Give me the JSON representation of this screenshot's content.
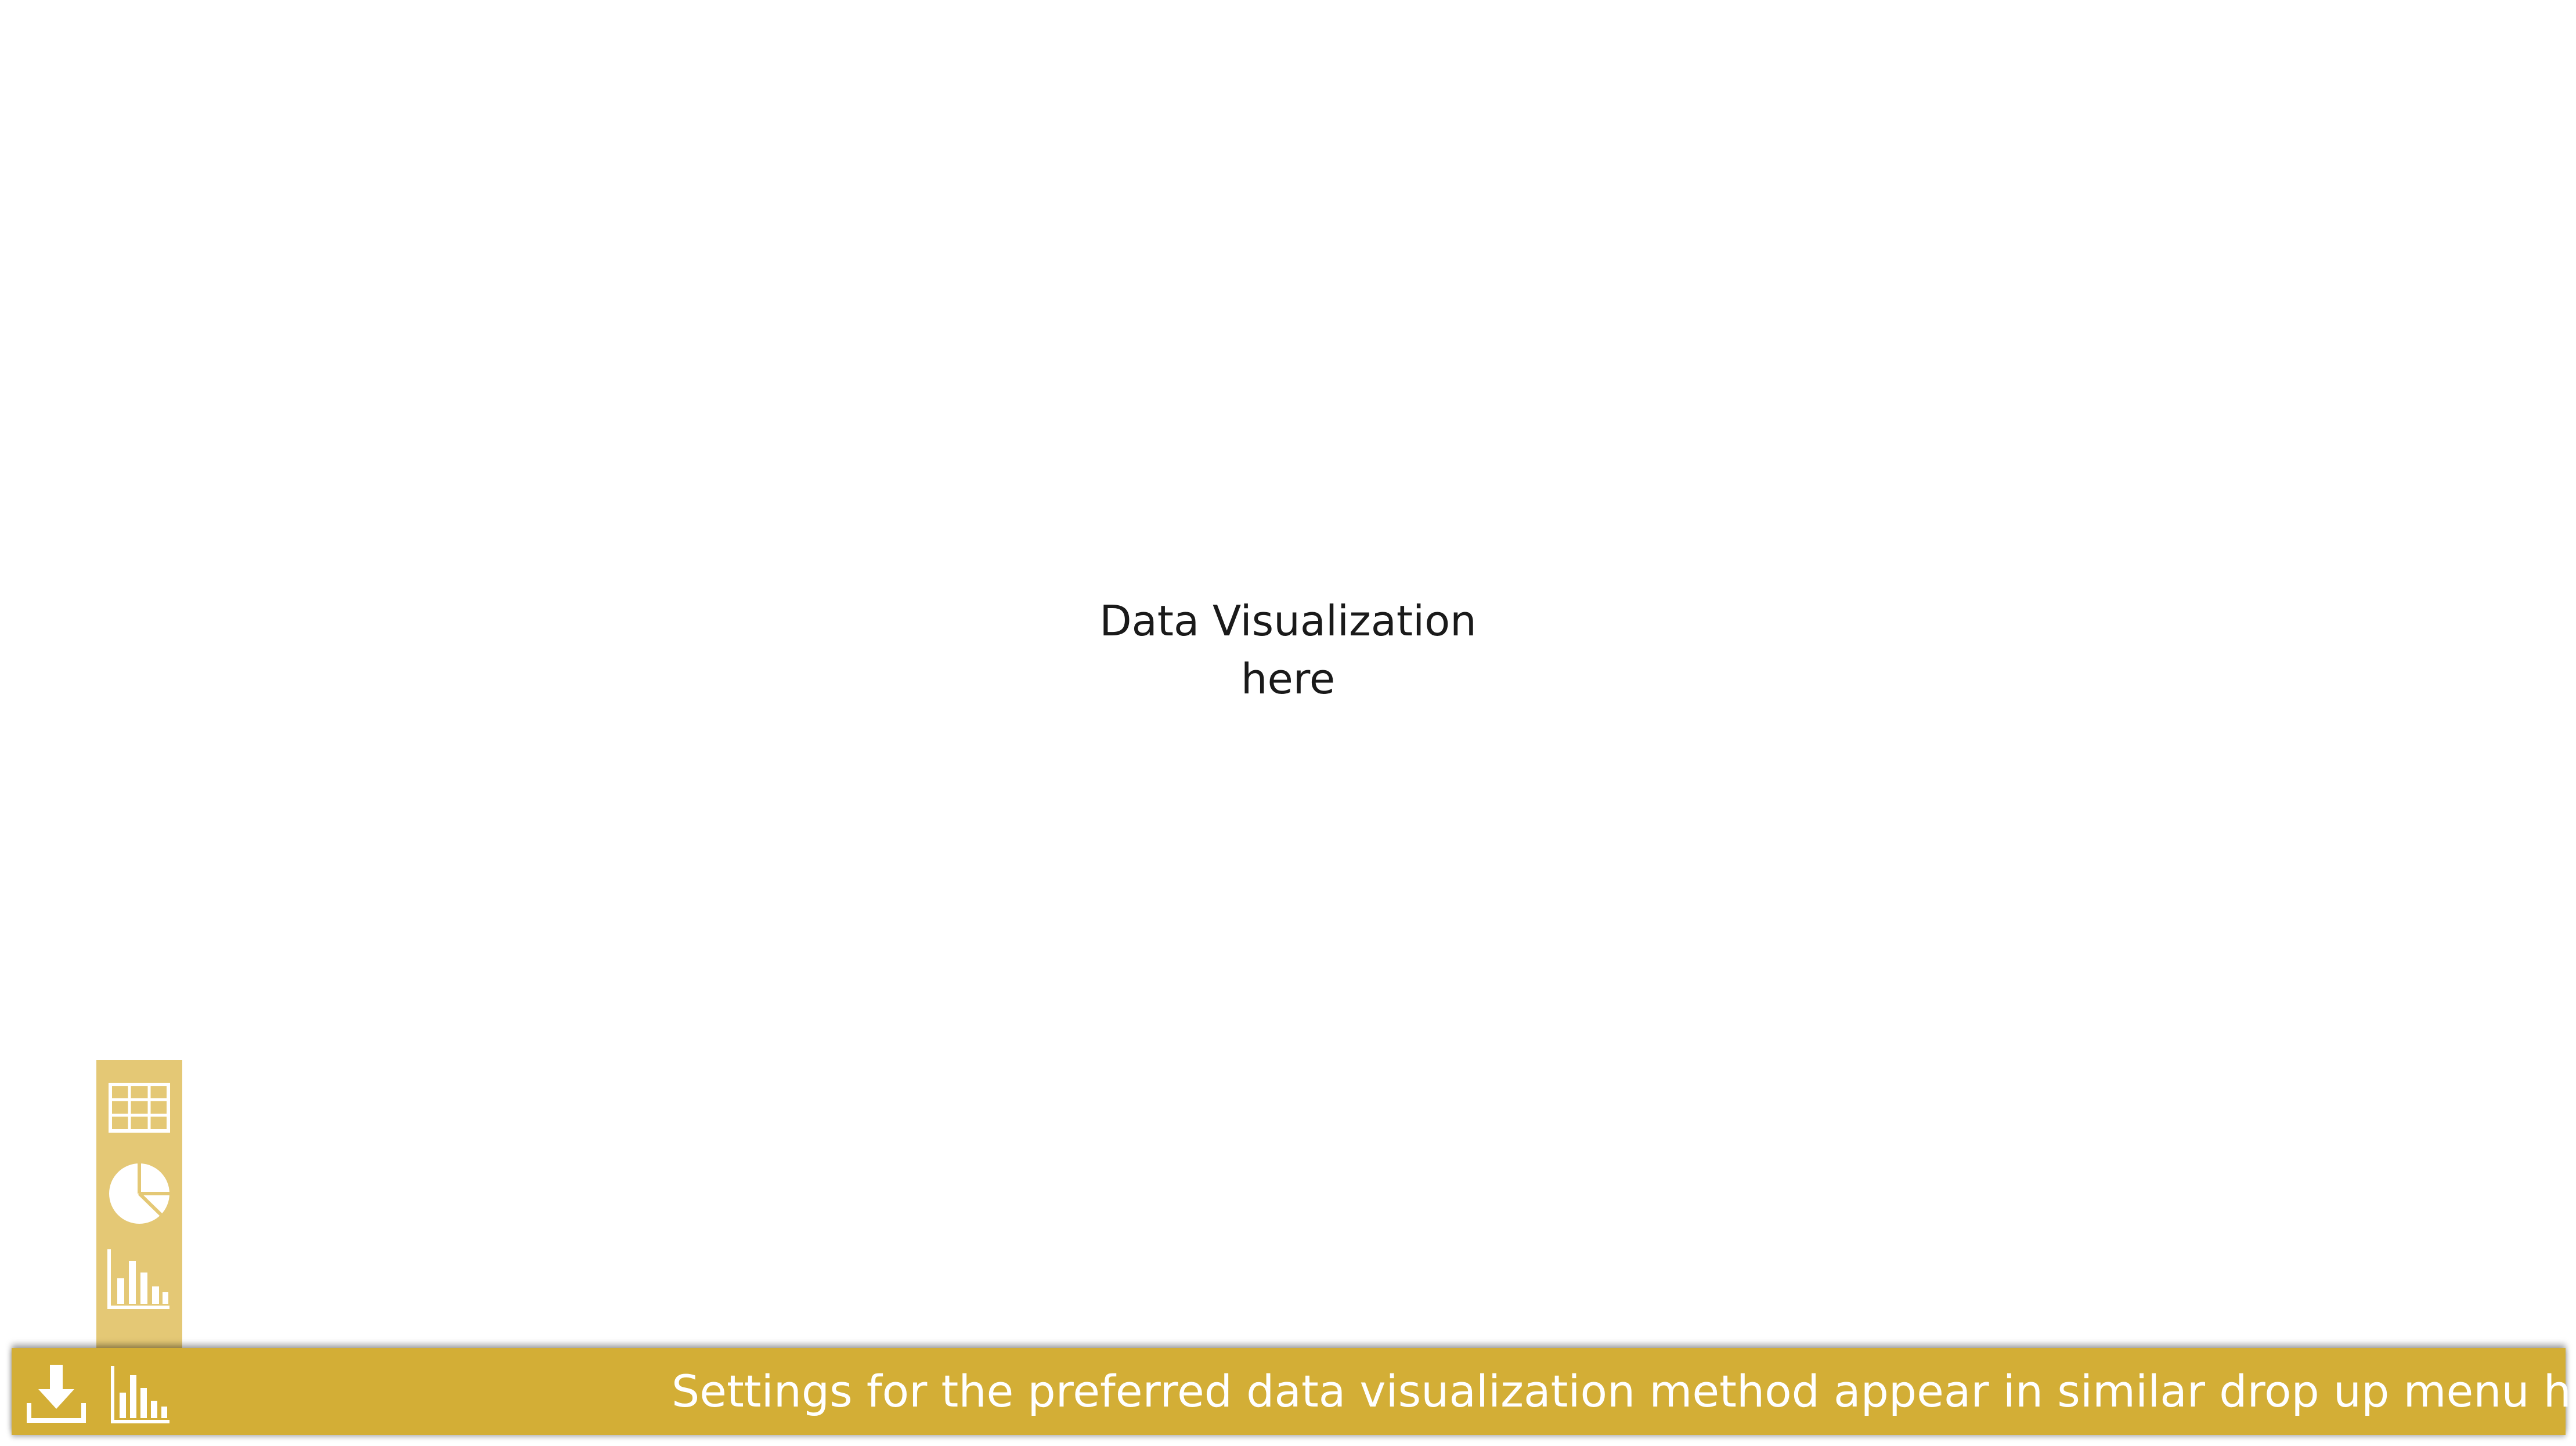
{
  "main": {
    "placeholder_line1": "Data Visualization",
    "placeholder_line2": "here"
  },
  "dropup": {
    "options": [
      {
        "icon": "table-icon"
      },
      {
        "icon": "pie-chart-icon"
      },
      {
        "icon": "bar-chart-icon"
      }
    ]
  },
  "bottom_bar": {
    "download_icon": "download-icon",
    "chart_icon": "bar-chart-icon",
    "message": "Settings for the preferred data visualization method appear in similar drop up menu here"
  },
  "colors": {
    "bar": "#d3ae36",
    "dropup": "#e4c875",
    "icon": "#ffffff"
  }
}
